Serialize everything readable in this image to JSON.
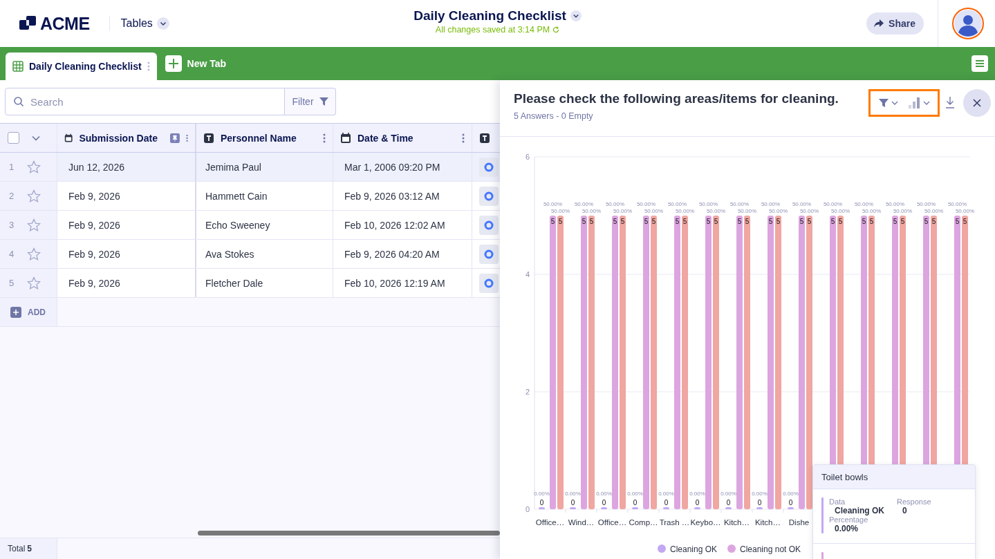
{
  "header": {
    "logo": "ACME",
    "app_menu": "Tables",
    "title": "Daily Cleaning Checklist",
    "save_status": "All changes saved at 3:14 PM",
    "share": "Share"
  },
  "tabs": [
    {
      "label": "Daily Cleaning Checklist",
      "selected": true
    }
  ],
  "new_tab": "New Tab",
  "toolbar": {
    "search": {
      "placeholder": "Search"
    },
    "filter": "Filter"
  },
  "table": {
    "select_all_checked": false,
    "columns": [
      {
        "label": "Submission Date",
        "kind": "date",
        "pinned": true
      },
      {
        "label": "Personnel Name",
        "kind": "text",
        "pinned": false
      },
      {
        "label": "Date & Time",
        "kind": "date",
        "pinned": false
      },
      {
        "kind": "text",
        "pinned": false
      }
    ],
    "rows": [
      {
        "number": "1",
        "selected": true,
        "cells": [
          "Jun 12, 2026",
          "Jemima Paul",
          "Mar 1, 2006 09:20 PM"
        ]
      },
      {
        "number": "2",
        "selected": false,
        "cells": [
          "Feb 9, 2026",
          "Hammett Cain",
          "Feb 9, 2026 03:12 AM"
        ]
      },
      {
        "number": "3",
        "selected": false,
        "cells": [
          "Feb 9, 2026",
          "Echo Sweeney",
          "Feb 10, 2026 12:02 AM"
        ]
      },
      {
        "number": "4",
        "selected": false,
        "cells": [
          "Feb 9, 2026",
          "Ava Stokes",
          "Feb 9, 2026 04:20 AM"
        ]
      },
      {
        "number": "5",
        "selected": false,
        "cells": [
          "Feb 9, 2026",
          "Fletcher Dale",
          "Feb 10, 2026 12:19 AM"
        ]
      }
    ],
    "add": "ADD",
    "footer_label": "Total",
    "footer_count": "5"
  },
  "panel": {
    "title": "Please check the following areas/items for cleaning.",
    "summary": "5 Answers - 0 Empty",
    "chart_data": {
      "type": "bar",
      "categories": [
        "Office…",
        "Wind…",
        "Office…",
        "Comp…",
        "Trash …",
        "Keybo…",
        "Kitch…",
        "Kitch…",
        "Dishe",
        null,
        null,
        null,
        null,
        null
      ],
      "ylim": [
        0,
        6
      ],
      "yticks": [
        {
          "value": 0,
          "label": "0"
        },
        {
          "value": 2,
          "label": "2"
        },
        {
          "value": 4,
          "label": "4"
        },
        {
          "value": 6,
          "label": "6"
        }
      ],
      "series": [
        {
          "name": "Cleaning OK",
          "color": "#c3a8f3",
          "values": [
            0,
            0,
            0,
            0,
            0,
            0,
            0,
            0,
            0,
            0,
            0,
            0,
            0,
            0
          ],
          "value_labels": [
            "0",
            "0",
            "0",
            "0",
            "0",
            "0",
            "0",
            "0",
            "0",
            null,
            null,
            null,
            null,
            null
          ]
        },
        {
          "name": "Cleaning not OK",
          "color": "#dca5e0",
          "values": [
            5,
            5,
            5,
            5,
            5,
            5,
            5,
            5,
            5,
            5,
            5,
            5,
            5,
            5
          ],
          "value_labels": [
            "5",
            "5",
            "5",
            "5",
            "5",
            "5",
            "5",
            "5",
            "5",
            "5",
            "5",
            "5",
            "5",
            "5"
          ]
        },
        {
          "color": "#f0a6a1",
          "values": [
            5,
            5,
            5,
            5,
            5,
            5,
            5,
            5,
            5,
            5,
            5,
            5,
            5,
            5
          ],
          "value_labels": [
            "5",
            "5",
            "5",
            "5",
            "5",
            "5",
            "5",
            "5",
            "5",
            "5",
            "5",
            "5",
            "5",
            "5"
          ]
        }
      ],
      "annotations": [
        {
          "text": "0.00%",
          "y": 0
        },
        {
          "text": "0.00%",
          "y": 0
        },
        {
          "text": "0.00%",
          "y": 0
        },
        {
          "text": "0.00%",
          "y": 0
        },
        {
          "text": "0.00%",
          "y": 0
        },
        {
          "text": "0.00%",
          "y": 0
        },
        {
          "text": "0.00%",
          "y": 0
        },
        {
          "text": "0.00%",
          "y": 0
        },
        {
          "text": "0.00%",
          "y": 0
        },
        {
          "text": "50.00%",
          "y": 5
        },
        {
          "text": "50.00%",
          "y": 5
        },
        {
          "text": "50.00%",
          "y": 5
        },
        {
          "text": "50.00%",
          "y": 5
        },
        {
          "text": "50.00%",
          "y": 5
        },
        {
          "text": "50.00%",
          "y": 5
        },
        {
          "text": "50.00%",
          "y": 5
        },
        {
          "text": "50.00%",
          "y": 5
        },
        {
          "text": "50.00%",
          "y": 5
        },
        {
          "text": "50.00%",
          "y": 5
        },
        {
          "text": "50.00%",
          "y": 5
        },
        {
          "text": "50.00%",
          "y": 5
        },
        {
          "text": "50.00%",
          "y": 5
        },
        {
          "text": "50.00%",
          "y": 5
        },
        {
          "text": "50.00%",
          "y": 5
        },
        {
          "text": "50.00%",
          "y": 5
        },
        {
          "text": "50.00%",
          "y": 5
        },
        {
          "text": "50.00%",
          "y": 5
        },
        {
          "text": "50.00%",
          "y": 5
        },
        {
          "text": "50.00%",
          "y": 5
        },
        {
          "text": "50.00%",
          "y": 5
        },
        {
          "text": "50.00%",
          "y": 5
        },
        {
          "text": "50.00%",
          "y": 5
        },
        {
          "text": "50.00%",
          "y": 5
        },
        {
          "text": "50.00%",
          "y": 5
        },
        {
          "text": "50.00%",
          "y": 5
        },
        {
          "text": "50.00%",
          "y": 5
        },
        {
          "text": "50.00%",
          "y": 5
        }
      ],
      "legend": true
    },
    "tooltip": {
      "title": "Toilet bowls",
      "entries": [
        {
          "color": "#c3a8f3",
          "data_label": "Data",
          "data": "Cleaning OK",
          "response_label": "Response",
          "response": "0",
          "percentage_label": "Percentage",
          "percentage": "0.00%"
        },
        {
          "color": "#dca5e0"
        }
      ]
    }
  }
}
